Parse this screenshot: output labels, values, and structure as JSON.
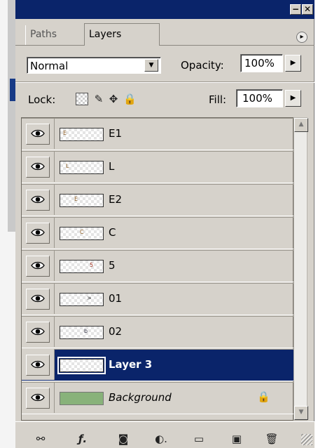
{
  "window": {
    "buttons": [
      {
        "label": "−"
      },
      {
        "label": "✕"
      }
    ]
  },
  "tabs": [
    {
      "label": "Paths",
      "active": false
    },
    {
      "label": "Layers",
      "active": true
    }
  ],
  "blend_mode": {
    "value": "Normal"
  },
  "opacity": {
    "label": "Opacity:",
    "value": "100%"
  },
  "lock": {
    "label": "Lock:"
  },
  "fill": {
    "label": "Fill:",
    "value": "100%"
  },
  "layers": [
    {
      "name": "E1"
    },
    {
      "name": "L"
    },
    {
      "name": "E2"
    },
    {
      "name": "C"
    },
    {
      "name": "5"
    },
    {
      "name": "01"
    },
    {
      "name": "02"
    },
    {
      "name": "Layer 3",
      "selected": true
    },
    {
      "name": "Background",
      "locked": true
    }
  ],
  "colors": {
    "title_bar": "#0a246a",
    "panel": "#d6d2cb",
    "selection": "#0a246a"
  },
  "icons": [
    "link-icon",
    "layer-style-icon",
    "mask-icon",
    "adjustment-layer-icon",
    "folder-icon",
    "new-layer-icon",
    "trash-icon"
  ]
}
